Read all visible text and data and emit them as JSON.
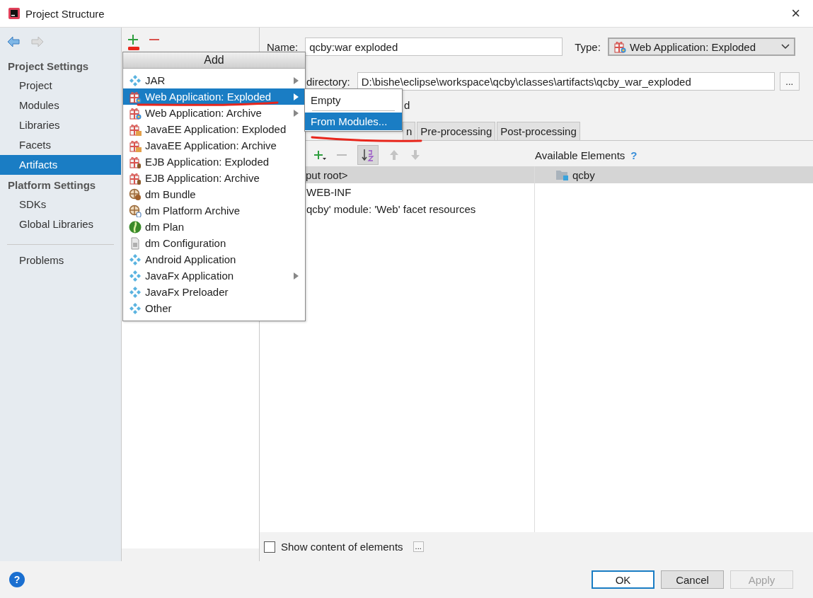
{
  "window": {
    "title": "Project Structure",
    "close": "×"
  },
  "sidebar": {
    "sections": [
      {
        "heading": "Project Settings",
        "items": [
          {
            "label": "Project",
            "selected": false
          },
          {
            "label": "Modules",
            "selected": false
          },
          {
            "label": "Libraries",
            "selected": false
          },
          {
            "label": "Facets",
            "selected": false
          },
          {
            "label": "Artifacts",
            "selected": true
          }
        ]
      },
      {
        "heading": "Platform Settings",
        "items": [
          {
            "label": "SDKs",
            "selected": false
          },
          {
            "label": "Global Libraries",
            "selected": false
          }
        ]
      }
    ],
    "footer_items": [
      {
        "label": "Problems",
        "selected": false
      }
    ]
  },
  "add_menu": {
    "title": "Add",
    "items": [
      {
        "label": "JAR",
        "kind": "module",
        "has_submenu": true,
        "selected": false
      },
      {
        "label": "Web Application: Exploded",
        "kind": "web",
        "has_submenu": true,
        "selected": true
      },
      {
        "label": "Web Application: Archive",
        "kind": "web",
        "has_submenu": true,
        "selected": false
      },
      {
        "label": "JavaEE Application: Exploded",
        "kind": "javaee",
        "has_submenu": false,
        "selected": false
      },
      {
        "label": "JavaEE Application: Archive",
        "kind": "javaee",
        "has_submenu": false,
        "selected": false
      },
      {
        "label": "EJB Application: Exploded",
        "kind": "ejb",
        "has_submenu": false,
        "selected": false
      },
      {
        "label": "EJB Application: Archive",
        "kind": "ejb",
        "has_submenu": false,
        "selected": false
      },
      {
        "label": "dm Bundle",
        "kind": "bundle",
        "has_submenu": false,
        "selected": false
      },
      {
        "label": "dm Platform Archive",
        "kind": "platform",
        "has_submenu": false,
        "selected": false
      },
      {
        "label": "dm Plan",
        "kind": "plan",
        "has_submenu": false,
        "selected": false
      },
      {
        "label": "dm Configuration",
        "kind": "config",
        "has_submenu": false,
        "selected": false
      },
      {
        "label": "Android Application",
        "kind": "module",
        "has_submenu": false,
        "selected": false
      },
      {
        "label": "JavaFx Application",
        "kind": "module",
        "has_submenu": true,
        "selected": false
      },
      {
        "label": "JavaFx Preloader",
        "kind": "module",
        "has_submenu": false,
        "selected": false
      },
      {
        "label": "Other",
        "kind": "module",
        "has_submenu": false,
        "selected": false
      }
    ]
  },
  "submenu": {
    "items": [
      {
        "label": "Empty",
        "selected": false
      },
      {
        "label": "From Modules...",
        "selected": true
      }
    ]
  },
  "editor": {
    "name_label": "Name:",
    "name_value": "qcby:war exploded",
    "type_label": "Type:",
    "type_value": "Web Application: Exploded",
    "output_label": "directory:",
    "output_value": "D:\\bishe\\eclipse\\workspace\\qcby\\classes\\artifacts\\qcby_war_exploded",
    "browse": "...",
    "partial_label": "d",
    "tabs": [
      {
        "label": "n",
        "selected": false
      },
      {
        "label": "Pre-processing",
        "selected": false
      },
      {
        "label": "Post-processing",
        "selected": false
      }
    ],
    "tree": {
      "label": "put root>",
      "selected": true,
      "children": [
        {
          "label": "WEB-INF"
        },
        {
          "label": "qcby' module: 'Web' facet resources"
        }
      ]
    },
    "available_title": "Available Elements",
    "available_help": "?",
    "available_items": [
      {
        "label": "qcby",
        "selected": true
      }
    ],
    "show_content": {
      "label": "Show content of elements",
      "checked": false,
      "more": "..."
    }
  },
  "footer": {
    "help": "?",
    "buttons": [
      {
        "label": "OK",
        "default": true,
        "disabled": false
      },
      {
        "label": "Cancel",
        "default": false,
        "disabled": false
      },
      {
        "label": "Apply",
        "default": false,
        "disabled": true
      }
    ]
  }
}
